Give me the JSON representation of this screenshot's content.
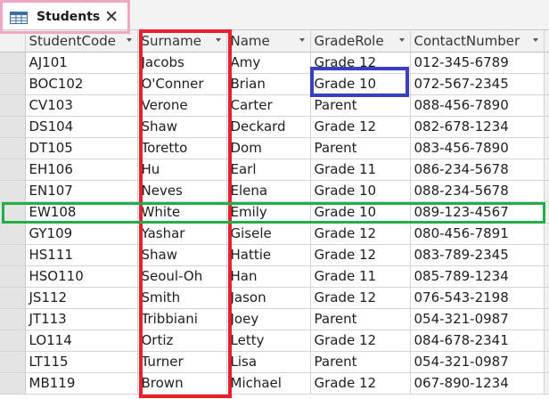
{
  "tab": {
    "label": "Students",
    "close": "✕"
  },
  "columns": [
    "StudentCode",
    "Surname",
    "Name",
    "GradeRole",
    "ContactNumber"
  ],
  "rows": [
    [
      "AJ101",
      "Jacobs",
      "Amy",
      "Grade 12",
      "012-345-6789"
    ],
    [
      "BOC102",
      "O'Conner",
      "Brian",
      "Grade 10",
      "072-567-2345"
    ],
    [
      "CV103",
      "Verone",
      "Carter",
      "Parent",
      "088-456-7890"
    ],
    [
      "DS104",
      "Shaw",
      "Deckard",
      "Grade 12",
      "082-678-1234"
    ],
    [
      "DT105",
      "Toretto",
      "Dom",
      "Parent",
      "083-456-7890"
    ],
    [
      "EH106",
      "Hu",
      "Earl",
      "Grade 11",
      "086-234-5678"
    ],
    [
      "EN107",
      "Neves",
      "Elena",
      "Grade 10",
      "088-234-5678"
    ],
    [
      "EW108",
      "White",
      "Emily",
      "Grade 10",
      "089-123-4567"
    ],
    [
      "GY109",
      "Yashar",
      "Gisele",
      "Grade 12",
      "080-456-7891"
    ],
    [
      "HS111",
      "Shaw",
      "Hattie",
      "Grade 12",
      "083-789-2345"
    ],
    [
      "HSO110",
      "Seoul-Oh",
      "Han",
      "Grade 11",
      "085-789-1234"
    ],
    [
      "JS112",
      "Smith",
      "Jason",
      "Grade 12",
      "076-543-2198"
    ],
    [
      "JT113",
      "Tribbiani",
      "Joey",
      "Parent",
      "054-321-0987"
    ],
    [
      "LO114",
      "Ortiz",
      "Letty",
      "Grade 12",
      "084-678-2341"
    ],
    [
      "LT115",
      "Turner",
      "Lisa",
      "Parent",
      "054-321-0987"
    ],
    [
      "MB119",
      "Brown",
      "Michael",
      "Grade 12",
      "067-890-1234"
    ]
  ],
  "colors": {
    "tab_highlight": "#f2a7c0",
    "column_highlight": "#e8202e",
    "cell_highlight": "#3a3fc0",
    "row_highlight": "#1fae4a"
  }
}
